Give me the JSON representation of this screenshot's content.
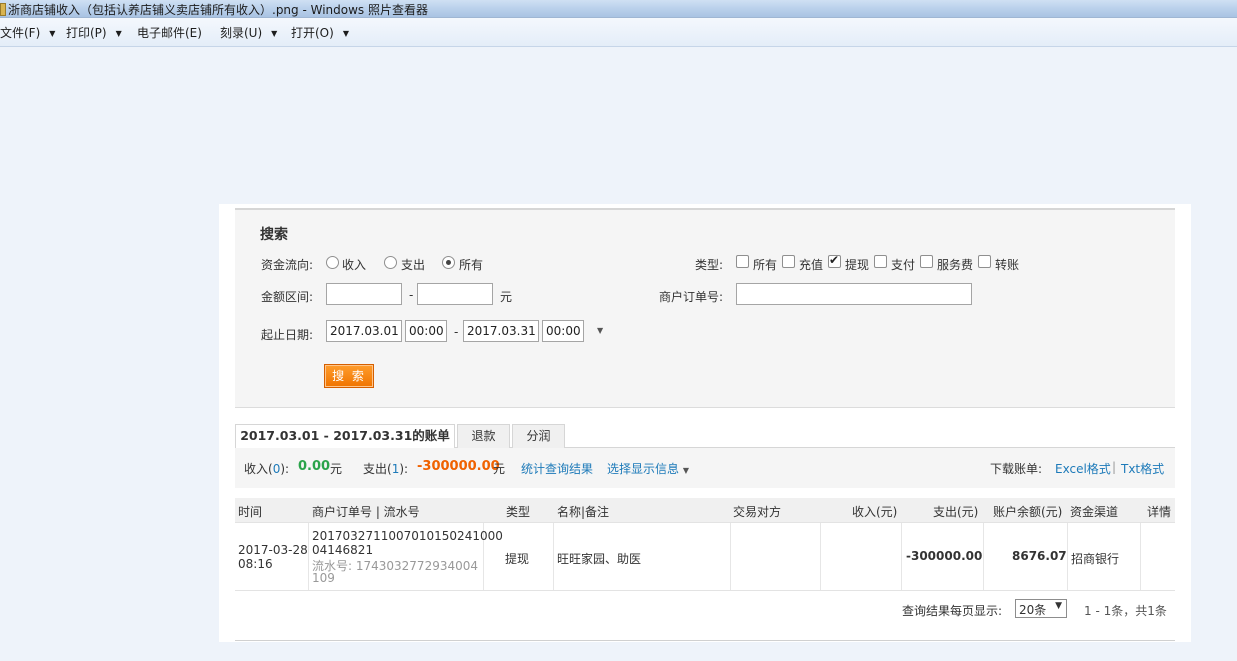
{
  "window": {
    "title": "浙商店铺收入（包括认养店铺义卖店铺所有收入）.png - Windows 照片查看器"
  },
  "menu": {
    "file": "文件(F)",
    "print": "打印(P)",
    "email": "电子邮件(E)",
    "burn": "刻录(U)",
    "open": "打开(O)"
  },
  "search": {
    "title": "搜索",
    "flow_label": "资金流向:",
    "flow_options": [
      "收入",
      "支出",
      "所有"
    ],
    "flow_selected": "所有",
    "type_label": "类型:",
    "type_options": [
      "所有",
      "充值",
      "提现",
      "支付",
      "服务费",
      "转账"
    ],
    "type_checked": [
      "提现"
    ],
    "amount_label": "金额区间:",
    "amount_sep": "-",
    "amount_unit": "元",
    "order_label": "商户订单号:",
    "date_label": "起止日期:",
    "start_date": "2017.03.01",
    "start_time": "00:00",
    "date_sep": "-",
    "end_date": "2017.03.31",
    "end_time": "00:00",
    "button": "搜 索"
  },
  "tabs": [
    "2017.03.01 - 2017.03.31的账单",
    "退款",
    "分润"
  ],
  "summary": {
    "income_label": "收入(",
    "income_count": "0",
    "income_close": "):",
    "income_amount": "0.00",
    "income_unit": "元",
    "expense_label": "支出(",
    "expense_count": "1",
    "expense_close": "):",
    "expense_amount": "-300000.00",
    "expense_unit": "元",
    "stats_link": "统计查询结果",
    "display_link": "选择显示信息",
    "download_label": "下载账单:",
    "excel_link": "Excel格式",
    "divider": "|",
    "txt_link": "Txt格式"
  },
  "table": {
    "headers": [
      "时间",
      "商户订单号 | 流水号",
      "类型",
      "名称|备注",
      "交易对方",
      "收入(元)",
      "支出(元)",
      "账户余额(元)",
      "资金渠道",
      "详情"
    ],
    "row": {
      "date": "2017-03-28",
      "time": "08:16",
      "order_line1": "2017032711007010150241000",
      "order_line2": "04146821",
      "serial_line1": "流水号: 1743032772934004",
      "serial_line2": "109",
      "type": "提现",
      "name": "旺旺家园、助医",
      "counterparty": "",
      "income": "",
      "expense": "-300000.00",
      "balance": "8676.07",
      "channel": "招商银行",
      "detail": ""
    }
  },
  "pager": {
    "label": "查询结果每页显示:",
    "per_page": "20条",
    "info": "1 - 1条，共1条"
  }
}
